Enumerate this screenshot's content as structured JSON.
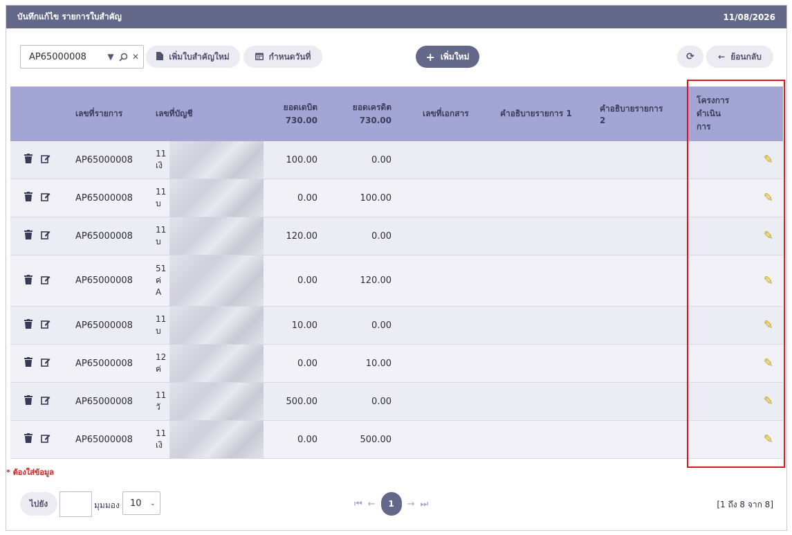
{
  "header": {
    "title": "บันทึกแก้ไข รายการใบสำคัญ",
    "date": "11/08/2026"
  },
  "toolbar": {
    "doc_value": "AP65000008",
    "add_voucher_label": "เพิ่มใบสำคัญใหม่",
    "set_date_label": "กำหนดวันที่",
    "add_new_label": "เพิ่มใหม่",
    "back_label": "ย้อนกลับ"
  },
  "table": {
    "headers": {
      "entry_no": "เลขที่รายการ",
      "account_no": "เลขที่บัญชี",
      "debit": "ยอดเดบิต",
      "debit_total": "730.00",
      "credit": "ยอดเครดิต",
      "credit_total": "730.00",
      "doc_no": "เลขที่เอกสาร",
      "desc1": "คำอธิบายรายการ 1",
      "desc2": "คำอธิบายรายการ 2",
      "project_1": "โครงการ",
      "project_2": "ดำเนิน",
      "project_3": "การ"
    },
    "rows": [
      {
        "entry_no": "AP65000008",
        "acc1": "11",
        "acc2": "เงิ",
        "acc3": "",
        "debit": "100.00",
        "credit": "0.00"
      },
      {
        "entry_no": "AP65000008",
        "acc1": "11",
        "acc2": "บ",
        "acc3": "",
        "debit": "0.00",
        "credit": "100.00"
      },
      {
        "entry_no": "AP65000008",
        "acc1": "11",
        "acc2": "บ",
        "acc3": "",
        "debit": "120.00",
        "credit": "0.00"
      },
      {
        "entry_no": "AP65000008",
        "acc1": "51",
        "acc2": "ค่",
        "acc3": "A",
        "debit": "0.00",
        "credit": "120.00"
      },
      {
        "entry_no": "AP65000008",
        "acc1": "11",
        "acc2": "บ",
        "acc3": "",
        "debit": "10.00",
        "credit": "0.00"
      },
      {
        "entry_no": "AP65000008",
        "acc1": "12",
        "acc2": "ค่",
        "acc3": "",
        "debit": "0.00",
        "credit": "10.00"
      },
      {
        "entry_no": "AP65000008",
        "acc1": "11",
        "acc2": "วั",
        "acc3": "",
        "debit": "500.00",
        "credit": "0.00"
      },
      {
        "entry_no": "AP65000008",
        "acc1": "11",
        "acc2": "เงิ",
        "acc3": "",
        "debit": "0.00",
        "credit": "500.00"
      }
    ]
  },
  "required_note": "* ต้องใส่ข้อมูล",
  "footer": {
    "goto_label": "ไปยัง",
    "view_label": "มุมมอง",
    "page_size": "10",
    "current_page": "1",
    "range_text": "[1 ถึง 8 จาก 8]"
  }
}
